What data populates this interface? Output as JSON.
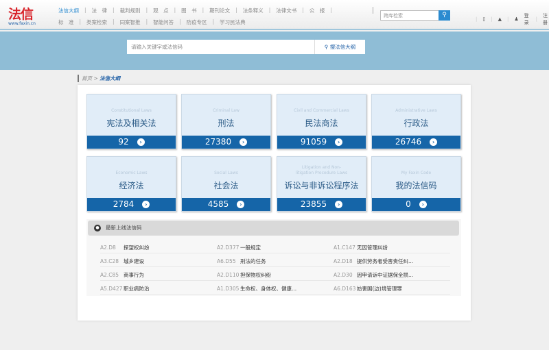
{
  "header": {
    "logo": "法信",
    "logo_url": "www.faxin.cn",
    "nav_row1": [
      "法信大纲",
      "法　律",
      "裁判规则",
      "观　点",
      "图　书",
      "期刊论文",
      "法条释义",
      "法律文书",
      "公　报"
    ],
    "nav_row2": [
      "标　准",
      "类案检索",
      "同案智推",
      "智能问答",
      "防疫专区",
      "学习民法典"
    ],
    "search_placeholder": "跨库检索",
    "login": "登录",
    "register": "注册"
  },
  "search": {
    "placeholder": "请输入关键字或法信码",
    "button": "搜法信大纲"
  },
  "breadcrumb": {
    "home": "首页",
    "sep": ">",
    "current": "法信大纲"
  },
  "cards": [
    {
      "en": "Constitutional Laws",
      "zh": "宪法及相关法",
      "count": "92"
    },
    {
      "en": "Criminal Law",
      "zh": "刑法",
      "count": "27380"
    },
    {
      "en": "Civil and Commercial Laws",
      "zh": "民法商法",
      "count": "91059"
    },
    {
      "en": "Administrative Laws",
      "zh": "行政法",
      "count": "26746"
    },
    {
      "en": "Economic Laws",
      "zh": "经济法",
      "count": "2784"
    },
    {
      "en": "Social Laws",
      "zh": "社会法",
      "count": "4585"
    },
    {
      "en": "Litigation and Non-litigation Procedure Laws",
      "zh": "诉讼与非诉讼程序法",
      "count": "23855"
    },
    {
      "en": "My Faxin Code",
      "zh": "我的法信码",
      "count": "0"
    }
  ],
  "latest": {
    "title": "最新上线法信码",
    "rows": [
      [
        {
          "code": "A2.D8",
          "text": "探望权纠纷"
        },
        {
          "code": "A2.D377",
          "text": "一般规定"
        },
        {
          "code": "A1.C147",
          "text": "无因管理纠纷"
        }
      ],
      [
        {
          "code": "A3.C28",
          "text": "城乡建设"
        },
        {
          "code": "A6.D55",
          "text": "刑法的任务"
        },
        {
          "code": "A2.D18",
          "text": "提供劳务者受害责任纠..."
        }
      ],
      [
        {
          "code": "A2.C85",
          "text": "商事行为"
        },
        {
          "code": "A2.D110",
          "text": "担保物权纠纷"
        },
        {
          "code": "A2.D30",
          "text": "因申请诉中证据保全损..."
        }
      ],
      [
        {
          "code": "A5.D427",
          "text": "职业病防治"
        },
        {
          "code": "A1.D305",
          "text": "生命权、身体权、健康..."
        },
        {
          "code": "A6.D163",
          "text": "妨害国(边)境管理罪"
        }
      ]
    ]
  }
}
